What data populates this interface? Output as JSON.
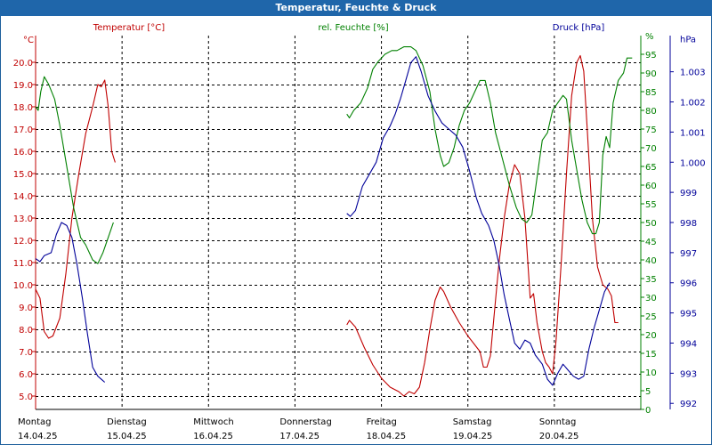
{
  "chart_data": {
    "type": "line",
    "title": "Temperatur, Feuchte & Druck",
    "axes": {
      "left": {
        "unit": "°C",
        "label": "Temperatur [°C]",
        "color": "#c00000",
        "ylim": [
          4.4,
          21.2
        ],
        "ticks": [
          "5.0",
          "6.0",
          "7.0",
          "8.0",
          "9.0",
          "10.0",
          "11.0",
          "12.0",
          "13.0",
          "14.0",
          "15.0",
          "16.0",
          "17.0",
          "18.0",
          "19.0",
          "20.0"
        ]
      },
      "middle": {
        "unit": "%",
        "label": "rel. Feuchte [%]",
        "color": "#008000",
        "ylim": [
          0,
          100
        ],
        "ticks": [
          "0",
          "5",
          "10",
          "15",
          "20",
          "25",
          "30",
          "35",
          "40",
          "45",
          "50",
          "55",
          "60",
          "65",
          "70",
          "75",
          "80",
          "85",
          "90",
          "95",
          "%"
        ]
      },
      "right": {
        "unit": "hPa",
        "label": "Druck [hPa]",
        "color": "#000099",
        "ylim": [
          991.8,
          1004.2
        ],
        "ticks": [
          "992",
          "993",
          "994",
          "995",
          "996",
          "997",
          "998",
          "999",
          "1.000",
          "1.001",
          "1.002",
          "1.003",
          "hPa"
        ]
      }
    },
    "x_labels": [
      {
        "day": "Montag",
        "date": "14.04.25"
      },
      {
        "day": "Dienstag",
        "date": "15.04.25"
      },
      {
        "day": "Mittwoch",
        "date": "16.04.25"
      },
      {
        "day": "Donnerstag",
        "date": "17.04.25"
      },
      {
        "day": "Freitag",
        "date": "18.04.25"
      },
      {
        "day": "Samstag",
        "date": "19.04.25"
      },
      {
        "day": "Sonntag",
        "date": "20.04.25"
      }
    ],
    "x_range_days": [
      0,
      7
    ],
    "grid": true,
    "series": [
      {
        "name": "Temperatur [°C]",
        "axis": "left",
        "color": "#c00000",
        "segments": [
          [
            [
              0.0,
              9.8
            ],
            [
              0.05,
              9.4
            ],
            [
              0.1,
              7.9
            ],
            [
              0.15,
              7.6
            ],
            [
              0.2,
              7.7
            ],
            [
              0.28,
              8.5
            ],
            [
              0.35,
              10.5
            ],
            [
              0.42,
              13.0
            ],
            [
              0.5,
              15.0
            ],
            [
              0.58,
              16.8
            ],
            [
              0.66,
              18.0
            ],
            [
              0.72,
              19.0
            ],
            [
              0.76,
              18.9
            ],
            [
              0.8,
              19.2
            ],
            [
              0.84,
              18.0
            ],
            [
              0.88,
              16.0
            ],
            [
              0.92,
              15.5
            ]
          ],
          [
            [
              3.6,
              8.2
            ],
            [
              3.63,
              8.4
            ],
            [
              3.7,
              8.1
            ],
            [
              3.8,
              7.2
            ],
            [
              3.9,
              6.4
            ],
            [
              4.0,
              5.8
            ],
            [
              4.1,
              5.4
            ],
            [
              4.2,
              5.2
            ],
            [
              4.26,
              5.0
            ],
            [
              4.32,
              5.2
            ],
            [
              4.38,
              5.1
            ],
            [
              4.44,
              5.4
            ],
            [
              4.5,
              6.5
            ],
            [
              4.56,
              8.0
            ],
            [
              4.62,
              9.3
            ],
            [
              4.68,
              9.9
            ],
            [
              4.72,
              9.7
            ],
            [
              4.8,
              9.0
            ],
            [
              4.9,
              8.3
            ],
            [
              5.0,
              7.7
            ],
            [
              5.08,
              7.3
            ],
            [
              5.14,
              7.0
            ],
            [
              5.18,
              6.3
            ],
            [
              5.22,
              6.3
            ],
            [
              5.26,
              6.8
            ],
            [
              5.3,
              8.5
            ],
            [
              5.36,
              11.0
            ],
            [
              5.42,
              13.0
            ],
            [
              5.48,
              14.5
            ],
            [
              5.54,
              15.4
            ],
            [
              5.6,
              15.0
            ],
            [
              5.66,
              13.0
            ],
            [
              5.72,
              9.4
            ],
            [
              5.76,
              9.6
            ],
            [
              5.8,
              8.3
            ],
            [
              5.86,
              7.0
            ],
            [
              5.9,
              6.5
            ],
            [
              5.94,
              6.3
            ],
            [
              5.98,
              6.0
            ],
            [
              6.02,
              7.5
            ],
            [
              6.08,
              11.0
            ],
            [
              6.14,
              15.0
            ],
            [
              6.2,
              18.5
            ],
            [
              6.26,
              20.0
            ],
            [
              6.3,
              20.3
            ],
            [
              6.34,
              19.6
            ],
            [
              6.38,
              17.0
            ],
            [
              6.44,
              13.0
            ],
            [
              6.5,
              10.8
            ],
            [
              6.56,
              10.0
            ],
            [
              6.62,
              9.8
            ],
            [
              6.66,
              9.5
            ],
            [
              6.7,
              8.3
            ],
            [
              6.74,
              8.3
            ]
          ]
        ]
      },
      {
        "name": "rel. Feuchte [%]",
        "axis": "middle",
        "color": "#008000",
        "segments": [
          [
            [
              0.0,
              81
            ],
            [
              0.03,
              80
            ],
            [
              0.06,
              85
            ],
            [
              0.1,
              89
            ],
            [
              0.15,
              87
            ],
            [
              0.22,
              83
            ],
            [
              0.28,
              76
            ],
            [
              0.36,
              65
            ],
            [
              0.44,
              54
            ],
            [
              0.52,
              46
            ],
            [
              0.58,
              44
            ],
            [
              0.66,
              40
            ],
            [
              0.72,
              39
            ],
            [
              0.78,
              42
            ],
            [
              0.84,
              46
            ],
            [
              0.9,
              50
            ]
          ],
          [
            [
              3.6,
              79
            ],
            [
              3.63,
              78
            ],
            [
              3.68,
              80
            ],
            [
              3.76,
              82
            ],
            [
              3.84,
              86
            ],
            [
              3.9,
              91
            ],
            [
              3.96,
              93
            ],
            [
              4.04,
              95
            ],
            [
              4.12,
              96
            ],
            [
              4.18,
              96
            ],
            [
              4.26,
              97
            ],
            [
              4.34,
              97
            ],
            [
              4.4,
              96
            ],
            [
              4.48,
              92
            ],
            [
              4.56,
              85
            ],
            [
              4.62,
              75
            ],
            [
              4.68,
              68
            ],
            [
              4.72,
              65
            ],
            [
              4.78,
              66
            ],
            [
              4.84,
              70
            ],
            [
              4.9,
              76
            ],
            [
              4.96,
              80
            ],
            [
              5.02,
              82
            ],
            [
              5.08,
              85
            ],
            [
              5.14,
              88
            ],
            [
              5.2,
              88
            ],
            [
              5.26,
              82
            ],
            [
              5.32,
              74
            ],
            [
              5.4,
              67
            ],
            [
              5.48,
              60
            ],
            [
              5.56,
              54
            ],
            [
              5.62,
              51
            ],
            [
              5.68,
              50
            ],
            [
              5.74,
              52
            ],
            [
              5.8,
              62
            ],
            [
              5.86,
              72
            ],
            [
              5.92,
              74
            ],
            [
              5.98,
              80
            ],
            [
              6.04,
              82
            ],
            [
              6.1,
              84
            ],
            [
              6.14,
              83
            ],
            [
              6.2,
              72
            ],
            [
              6.26,
              64
            ],
            [
              6.32,
              56
            ],
            [
              6.38,
              50
            ],
            [
              6.44,
              47
            ],
            [
              6.48,
              47
            ],
            [
              6.52,
              50
            ],
            [
              6.56,
              68
            ],
            [
              6.6,
              73
            ],
            [
              6.64,
              70
            ],
            [
              6.68,
              82
            ],
            [
              6.74,
              88
            ],
            [
              6.8,
              90
            ],
            [
              6.84,
              94
            ],
            [
              6.9,
              94
            ]
          ]
        ]
      },
      {
        "name": "Druck [hPa]",
        "axis": "right",
        "color": "#000099",
        "segments": [
          [
            [
              0.0,
              996.8
            ],
            [
              0.05,
              996.7
            ],
            [
              0.1,
              996.9
            ],
            [
              0.18,
              997.0
            ],
            [
              0.24,
              997.6
            ],
            [
              0.3,
              998.0
            ],
            [
              0.36,
              997.9
            ],
            [
              0.42,
              997.5
            ],
            [
              0.48,
              996.6
            ],
            [
              0.54,
              995.5
            ],
            [
              0.6,
              994.3
            ],
            [
              0.66,
              993.2
            ],
            [
              0.72,
              992.9
            ],
            [
              0.76,
              992.8
            ],
            [
              0.8,
              992.7
            ]
          ],
          [
            [
              3.6,
              998.3
            ],
            [
              3.64,
              998.2
            ],
            [
              3.7,
              998.4
            ],
            [
              3.78,
              999.2
            ],
            [
              3.86,
              999.6
            ],
            [
              3.94,
              1000.0
            ],
            [
              4.02,
              1000.8
            ],
            [
              4.1,
              1001.2
            ],
            [
              4.16,
              1001.6
            ],
            [
              4.22,
              1002.1
            ],
            [
              4.28,
              1002.7
            ],
            [
              4.34,
              1003.3
            ],
            [
              4.4,
              1003.5
            ],
            [
              4.46,
              1003.0
            ],
            [
              4.54,
              1002.2
            ],
            [
              4.62,
              1001.7
            ],
            [
              4.7,
              1001.3
            ],
            [
              4.78,
              1001.1
            ],
            [
              4.86,
              1000.9
            ],
            [
              4.94,
              1000.5
            ],
            [
              5.02,
              999.7
            ],
            [
              5.1,
              998.8
            ],
            [
              5.16,
              998.3
            ],
            [
              5.24,
              997.9
            ],
            [
              5.3,
              997.4
            ],
            [
              5.36,
              996.6
            ],
            [
              5.42,
              995.6
            ],
            [
              5.48,
              994.8
            ],
            [
              5.54,
              994.0
            ],
            [
              5.6,
              993.8
            ],
            [
              5.66,
              994.1
            ],
            [
              5.72,
              994.0
            ],
            [
              5.78,
              993.6
            ],
            [
              5.86,
              993.3
            ],
            [
              5.92,
              992.8
            ],
            [
              5.98,
              992.6
            ],
            [
              6.04,
              993.0
            ],
            [
              6.1,
              993.3
            ],
            [
              6.16,
              993.1
            ],
            [
              6.22,
              992.9
            ],
            [
              6.28,
              992.8
            ],
            [
              6.34,
              992.9
            ],
            [
              6.4,
              993.8
            ],
            [
              6.46,
              994.5
            ],
            [
              6.52,
              995.1
            ],
            [
              6.58,
              995.7
            ],
            [
              6.64,
              996.0
            ]
          ]
        ]
      }
    ]
  }
}
